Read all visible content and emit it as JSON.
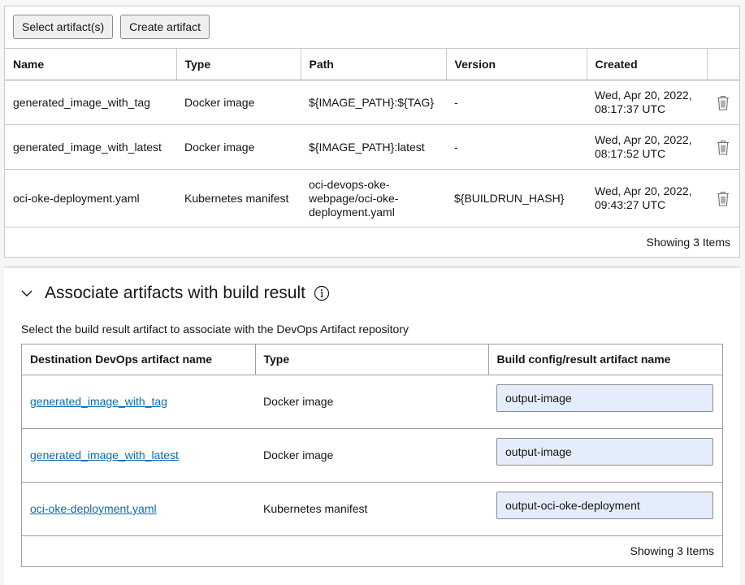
{
  "toolbar": {
    "select_label": "Select artifact(s)",
    "create_label": "Create artifact"
  },
  "artifacts_table": {
    "headers": [
      "Name",
      "Type",
      "Path",
      "Version",
      "Created"
    ],
    "rows": [
      {
        "name": "generated_image_with_tag",
        "type": "Docker image",
        "path": "${IMAGE_PATH}:${TAG}",
        "version": "-",
        "created_line1": "Wed, Apr 20, 2022,",
        "created_line2": "08:17:37 UTC"
      },
      {
        "name": "generated_image_with_latest",
        "type": "Docker image",
        "path": "${IMAGE_PATH}:latest",
        "version": "-",
        "created_line1": "Wed, Apr 20, 2022,",
        "created_line2": "08:17:52 UTC"
      },
      {
        "name": "oci-oke-deployment.yaml",
        "type": "Kubernetes manifest",
        "path_line1": "oci-devops-oke-",
        "path_line2": "webpage/oci-oke-",
        "path_line3": "deployment.yaml",
        "version": "${BUILDRUN_HASH}",
        "created_line1": "Wed, Apr 20, 2022,",
        "created_line2": "09:43:27 UTC"
      }
    ],
    "footer": "Showing 3 Items"
  },
  "associate_section": {
    "title": "Associate artifacts with build result",
    "description": "Select the build result artifact to associate with the DevOps Artifact repository",
    "headers": [
      "Destination DevOps artifact name",
      "Type",
      "Build config/result artifact name"
    ],
    "rows": [
      {
        "name": "generated_image_with_tag",
        "type": "Docker image",
        "result": "output-image"
      },
      {
        "name": "generated_image_with_latest",
        "type": "Docker image",
        "result": "output-image"
      },
      {
        "name": "oci-oke-deployment.yaml",
        "type": "Kubernetes manifest",
        "result": "output-oci-oke-deployment"
      }
    ],
    "footer": "Showing 3 Items"
  },
  "icons": {
    "delete": "trash-icon",
    "collapse": "chevron-down-icon",
    "info": "info-icon"
  },
  "colors": {
    "link": "#0b6bb0",
    "field_bg": "#e3edfb"
  }
}
